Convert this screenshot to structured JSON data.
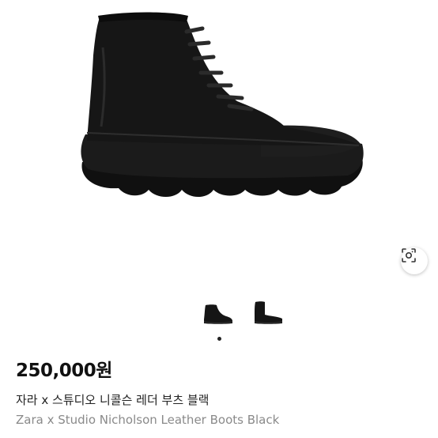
{
  "product": {
    "price": "250,000원",
    "title_korean": "자라 x 스튜디오 니콜슨 레더 부츠 블랙",
    "title_english": "Zara x Studio Nicholson Leather Boots Black"
  },
  "gallery": {
    "thumbnail_count": 2,
    "active_page": 1,
    "page_count": 1
  },
  "icons": {
    "lens": "visual-search-icon"
  },
  "colors": {
    "boot": "#141414",
    "background": "#ffffff",
    "price_text": "#111111",
    "secondary_text": "#8a8a8a"
  }
}
